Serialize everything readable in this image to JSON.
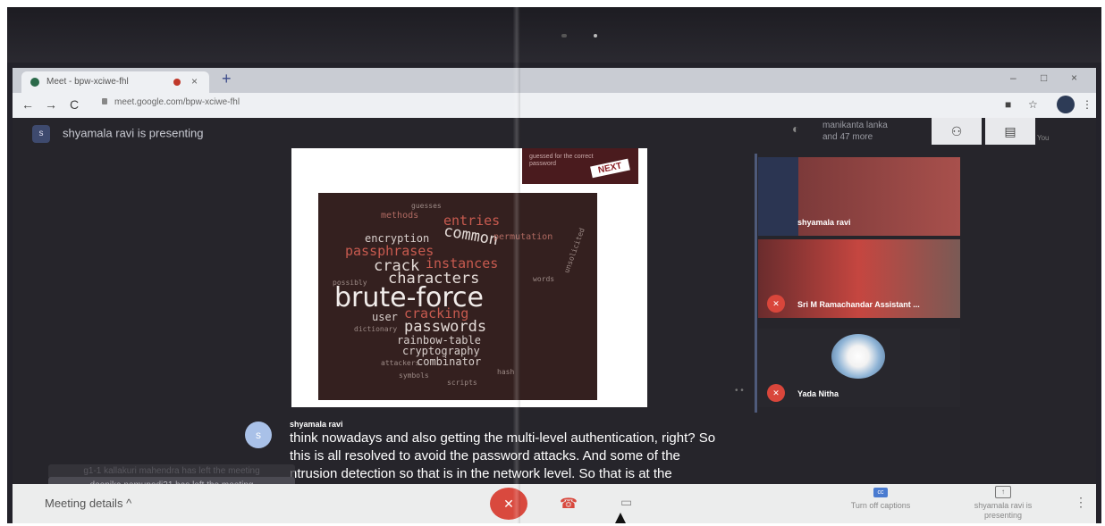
{
  "browser": {
    "tab_title": "Meet - bpw-xciwe-fhl",
    "tab_close": "×",
    "new_tab": "+",
    "url": "meet.google.com/bpw-xciwe-fhl",
    "window_controls": [
      "–",
      "□",
      "×"
    ]
  },
  "meet": {
    "presenting_text": "shyamala ravi is presenting",
    "presenter_avatar_letter": "s",
    "participants_line1": "manikanta lanka",
    "participants_line2": "and 47 more",
    "you_label": "You",
    "slide": {
      "next_caption": "guessed for the correct password",
      "next_button": "NEXT",
      "wordcloud": [
        "methods",
        "entries",
        "encryption",
        "common",
        "permutation",
        "passphrases",
        "crack",
        "instances",
        "characters",
        "brute-force",
        "cracking",
        "user",
        "passwords",
        "rainbow-table",
        "cryptography",
        "combinator",
        "guesses",
        "unsolicited",
        "words",
        "possibly",
        "dictionary",
        "attackers",
        "hash",
        "symbols",
        "scripts"
      ]
    },
    "tiles": [
      {
        "name": "shyamala ravi"
      },
      {
        "name": "Sri M Ramachandar Assistant ..."
      },
      {
        "name": "Yada Nitha"
      }
    ],
    "caption": {
      "avatar_letter": "s",
      "speaker": "shyamala ravi",
      "line1": "think nowadays and also getting the multi-level authentication, right? So",
      "line2": "this is all resolved to avoid the password attacks. And some of the",
      "line3": "ntrusion detection so that is in the network level. So that is at the"
    },
    "toast_faint": "g1-1 kallakuri mahendra has left the meeting",
    "toast": "deepika nemupodi21 has left the meeting"
  },
  "bottom_bar": {
    "meeting_details": "Meeting details",
    "chevron": "^",
    "captions_label": "Turn off captions",
    "present_label": "shyamala ravi is presenting",
    "more": "⋮"
  }
}
